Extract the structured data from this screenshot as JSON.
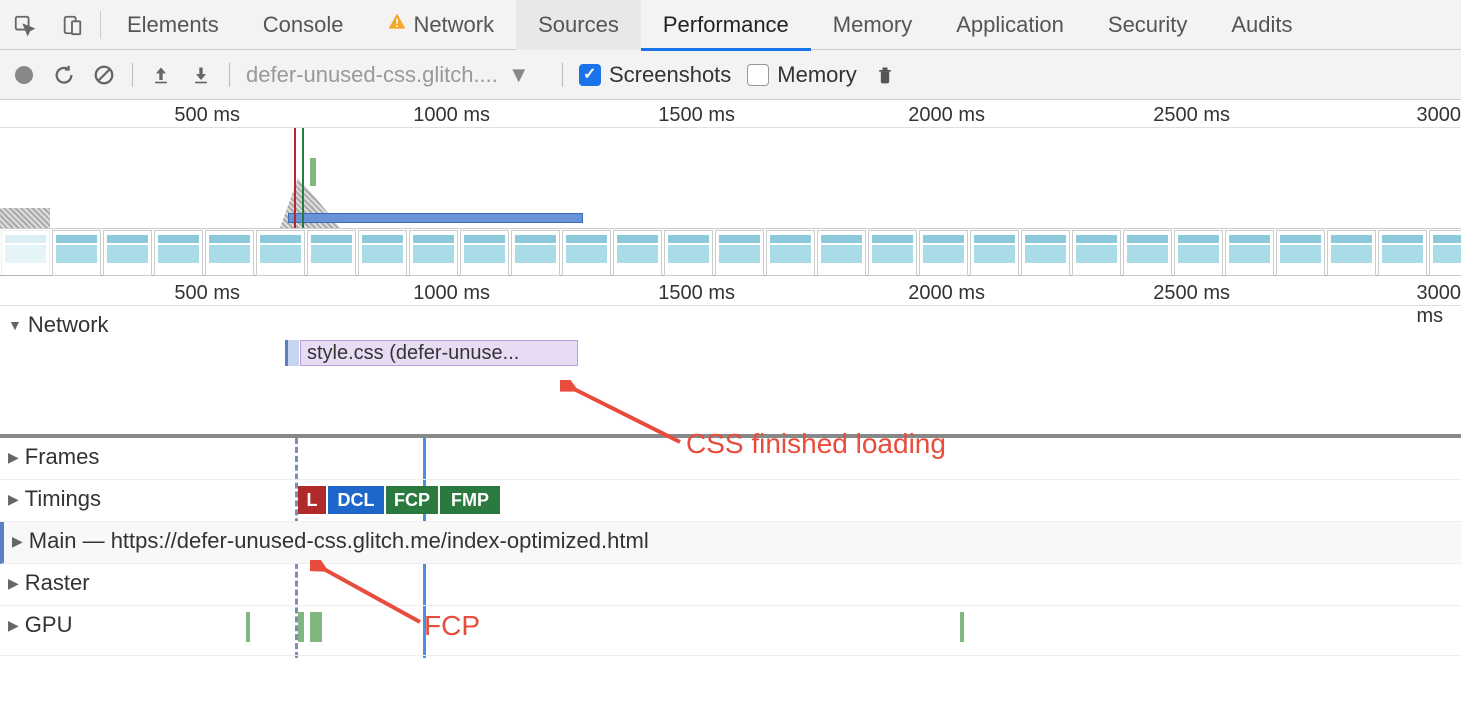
{
  "tabs": [
    "Elements",
    "Console",
    "Network",
    "Sources",
    "Performance",
    "Memory",
    "Application",
    "Security",
    "Audits"
  ],
  "active_tab": "Performance",
  "warn_tab": "Network",
  "toolbar": {
    "dropdown": "defer-unused-css.glitch....",
    "screenshots_label": "Screenshots",
    "memory_label": "Memory",
    "screenshots_checked": true,
    "memory_checked": false
  },
  "overview_ticks": [
    "500 ms",
    "1000 ms",
    "1500 ms",
    "2000 ms",
    "2500 ms",
    "3000"
  ],
  "detail_ticks": [
    "500 ms",
    "1000 ms",
    "1500 ms",
    "2000 ms",
    "2500 ms",
    "3000 ms"
  ],
  "tracks": {
    "network": "Network",
    "frames": "Frames",
    "timings": "Timings",
    "main": "Main — https://defer-unused-css.glitch.me/index-optimized.html",
    "raster": "Raster",
    "gpu": "GPU"
  },
  "network_item": "style.css (defer-unuse...",
  "timing_markers": [
    {
      "label": "L",
      "color": "#b02a2a"
    },
    {
      "label": "DCL",
      "color": "#1e66c9"
    },
    {
      "label": "FCP",
      "color": "#2a7a3f"
    },
    {
      "label": "FMP",
      "color": "#2a7a3f"
    }
  ],
  "annotations": {
    "css_loaded": "CSS finished loading",
    "fcp": "FCP"
  }
}
